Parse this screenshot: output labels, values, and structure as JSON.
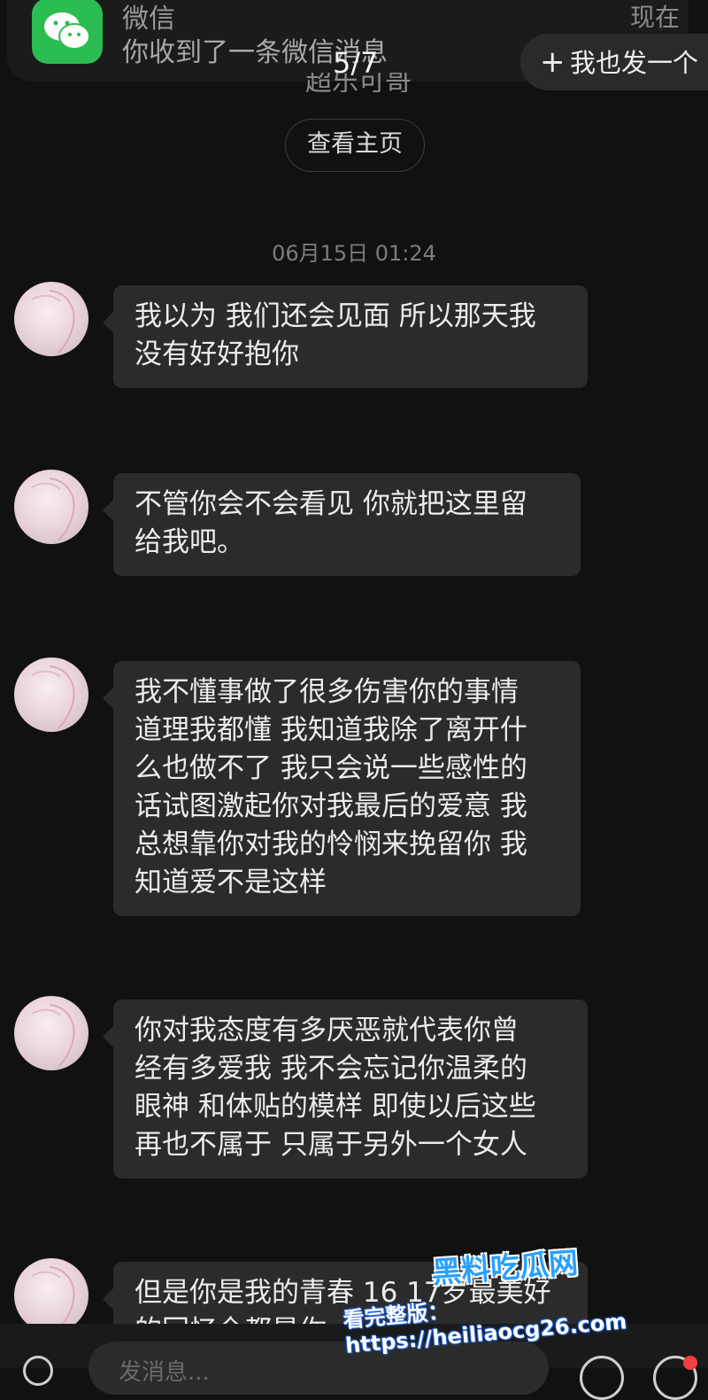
{
  "notification": {
    "app_name": "微信",
    "message": "你收到了一条微信消息",
    "time": "现在",
    "icon": "wechat-icon"
  },
  "viewer": {
    "page_indicator": "5/7",
    "post_button_label": "我也发一个",
    "post_button_icon": "plus-icon"
  },
  "header": {
    "truncated_text": "超乐可哥",
    "view_home_label": "查看主页"
  },
  "chat": {
    "timestamp": "06月15日 01:24",
    "messages": [
      {
        "lines": [
          "我以为 我们还会见面 所以那天我",
          "没有好好抱你"
        ]
      },
      {
        "lines": [
          "不管你会不会看见 你就把这里留",
          "给我吧。"
        ]
      },
      {
        "lines": [
          "我不懂事做了很多伤害你的事情",
          "道理我都懂 我知道我除了离开什",
          "么也做不了 我只会说一些感性的",
          "话试图激起你对我最后的爱意 我",
          "总想靠你对我的怜悯来挽留你 我",
          "知道爱不是这样"
        ]
      },
      {
        "lines": [
          "你对我态度有多厌恶就代表你曾",
          "经有多爱我 我不会忘记你温柔的",
          "眼神 和体贴的模样 即使以后这些",
          "再也不属于 只属于另外一个女人"
        ]
      },
      {
        "lines": [
          "但是你是我的青春 16 17岁最美好",
          "的回忆全都是你"
        ]
      }
    ]
  },
  "input": {
    "placeholder": "发消息..."
  },
  "watermark": {
    "line1": "黑料吃瓜网",
    "line2": "看完整版：https://heiliaocg26.com"
  },
  "colors": {
    "background": "#111111",
    "bubble": "#2b2b2b",
    "wechat_green": "#2cbd52",
    "watermark_blue": "#2aa0ff"
  }
}
